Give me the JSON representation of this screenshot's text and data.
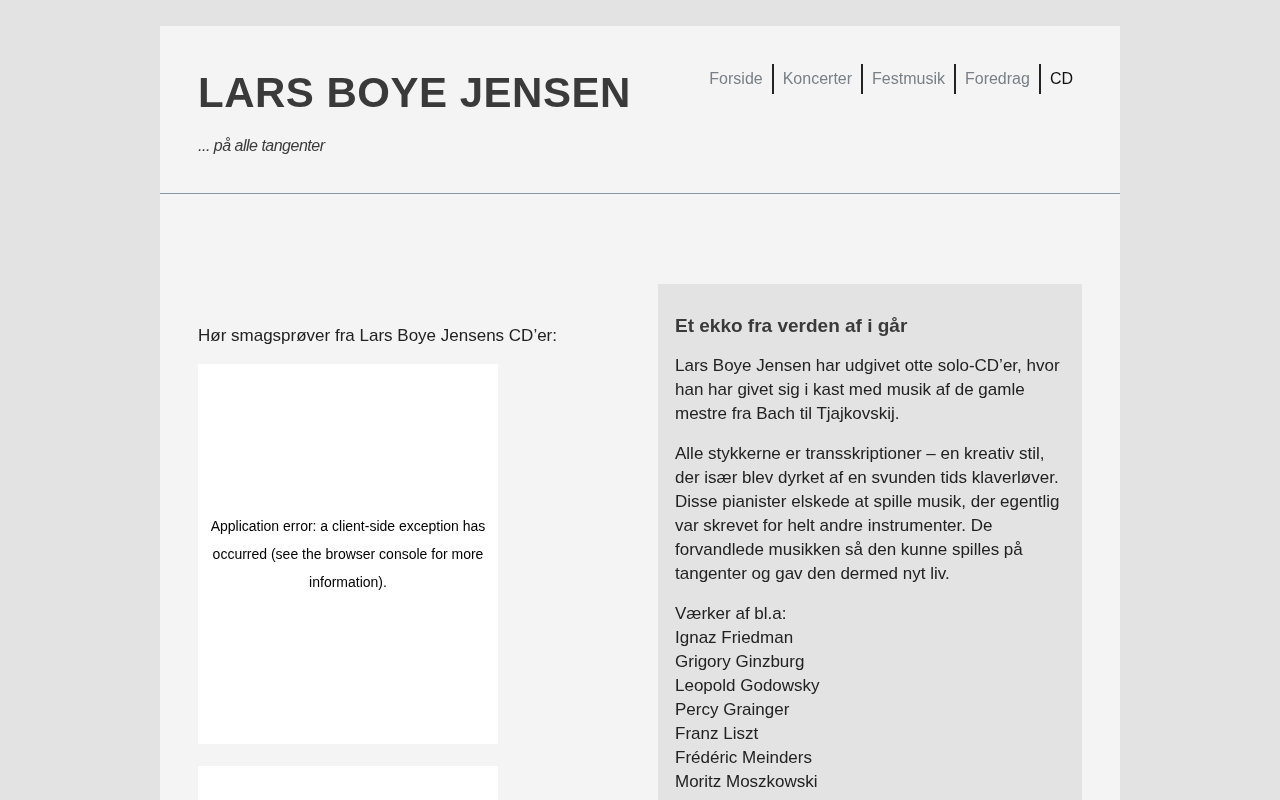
{
  "header": {
    "title": "LARS BOYE JENSEN",
    "tagline": "... på alle tangenter"
  },
  "nav": [
    {
      "label": "Forside",
      "selected": false
    },
    {
      "label": "Koncerter",
      "selected": false
    },
    {
      "label": "Festmusik",
      "selected": false
    },
    {
      "label": "Foredrag",
      "selected": false
    },
    {
      "label": "CD",
      "selected": true
    }
  ],
  "main": {
    "intro": "Hør smagsprøver fra Lars Boye Jensens CD’er:",
    "embeds": [
      {
        "kind": "error",
        "error": "Application error: a client-side exception has occurred (see the browser console for more information)."
      },
      {
        "kind": "blank"
      }
    ]
  },
  "aside": {
    "heading": "Et ekko fra verden af i går",
    "paragraphs": [
      "Lars Boye Jensen har udgivet otte solo-CD’er, hvor han har givet sig i kast med musik af de gamle mestre fra Bach til Tjajkovskij.",
      "Alle stykkerne er transskriptioner – en kreativ stil, der især blev dyrket af en svunden tids klaverløver. Disse pianister elskede at spille musik, der egentlig var skrevet for helt andre instrumenter. De forvandlede musikken så den kunne spilles på tangenter og gav den dermed nyt liv."
    ],
    "list_heading": "Værker af bl.a:",
    "composers": [
      "Ignaz Friedman",
      "Grigory Ginzburg",
      "Leopold Godowsky",
      "Percy Grainger",
      "Franz Liszt",
      "Frédéric Meinders",
      "Moritz Moszkowski"
    ]
  }
}
